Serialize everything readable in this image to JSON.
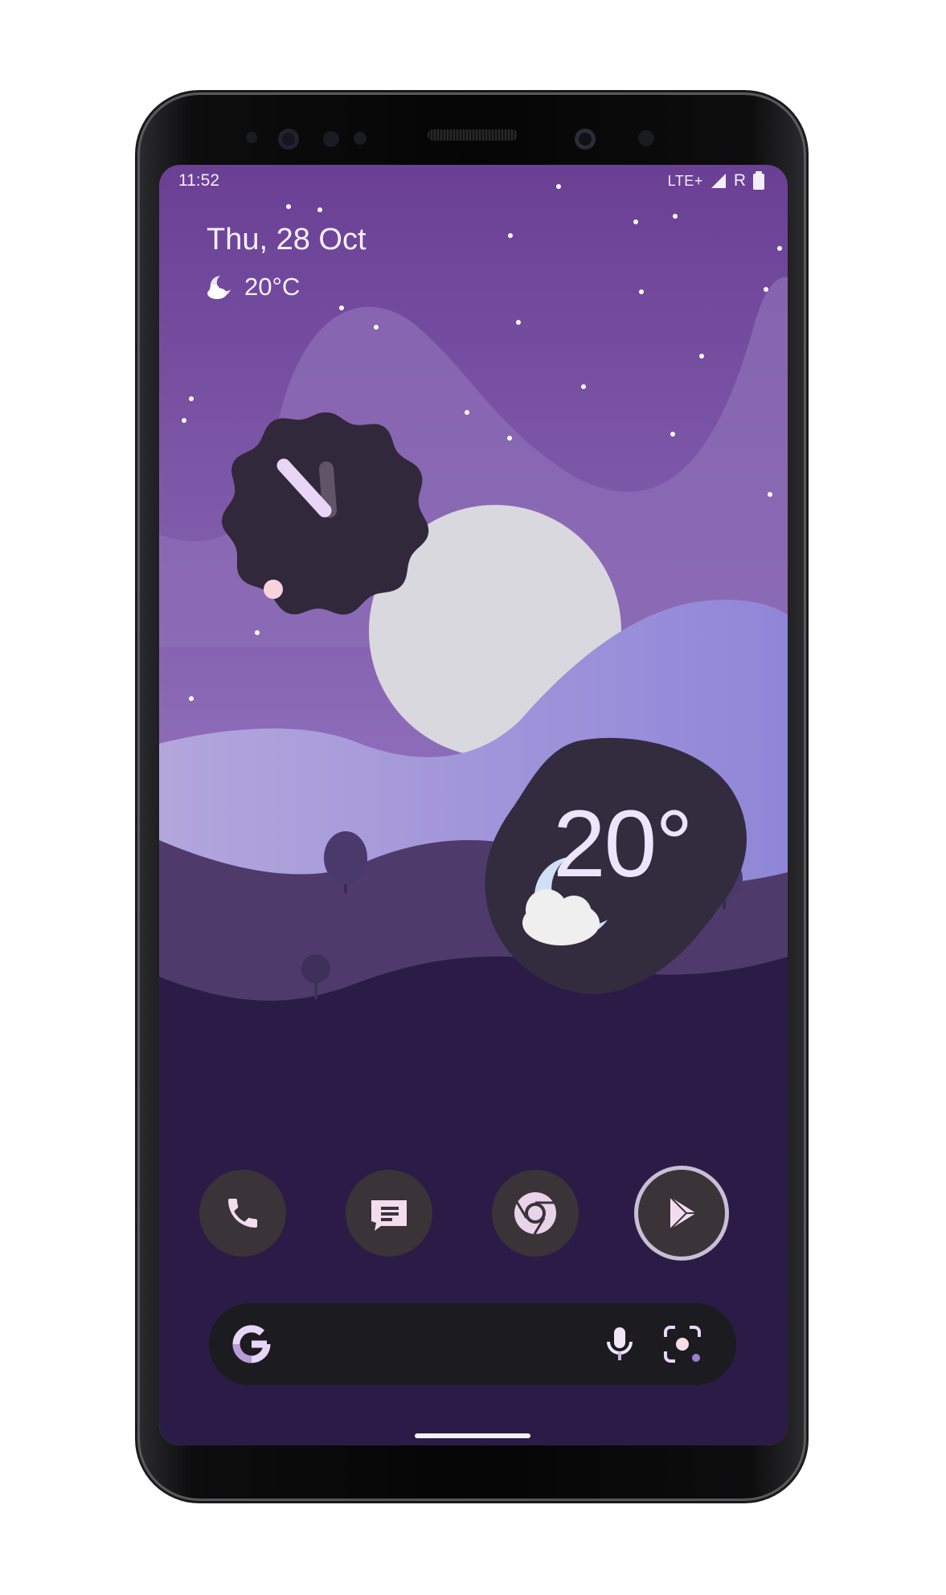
{
  "status_bar": {
    "time": "11:52",
    "network": "LTE+",
    "roaming": "R"
  },
  "at_a_glance": {
    "date": "Thu, 28 Oct",
    "temperature": "20°C",
    "weather_icon": "moon-cloud-icon"
  },
  "weather_widget": {
    "temperature": "20°",
    "icon": "cloudy-night-icon"
  },
  "clock_widget": {
    "icon": "analog-clock"
  },
  "dock": {
    "apps": [
      {
        "name": "Phone",
        "icon": "phone-icon"
      },
      {
        "name": "Messages",
        "icon": "messages-icon"
      },
      {
        "name": "Chrome",
        "icon": "chrome-icon"
      },
      {
        "name": "Play Store",
        "icon": "play-store-icon"
      }
    ]
  },
  "search_bar": {
    "logo": "G",
    "voice_icon": "mic-icon",
    "lens_icon": "lens-icon"
  },
  "colors": {
    "sky_top": "#6a3f94",
    "moon": "#d9d8df",
    "widget_dark": "#332c3f",
    "dock_icon_bg": "#3a3338",
    "search_bg": "#1c1b1f",
    "accent_lilac": "#e9d6f7"
  }
}
